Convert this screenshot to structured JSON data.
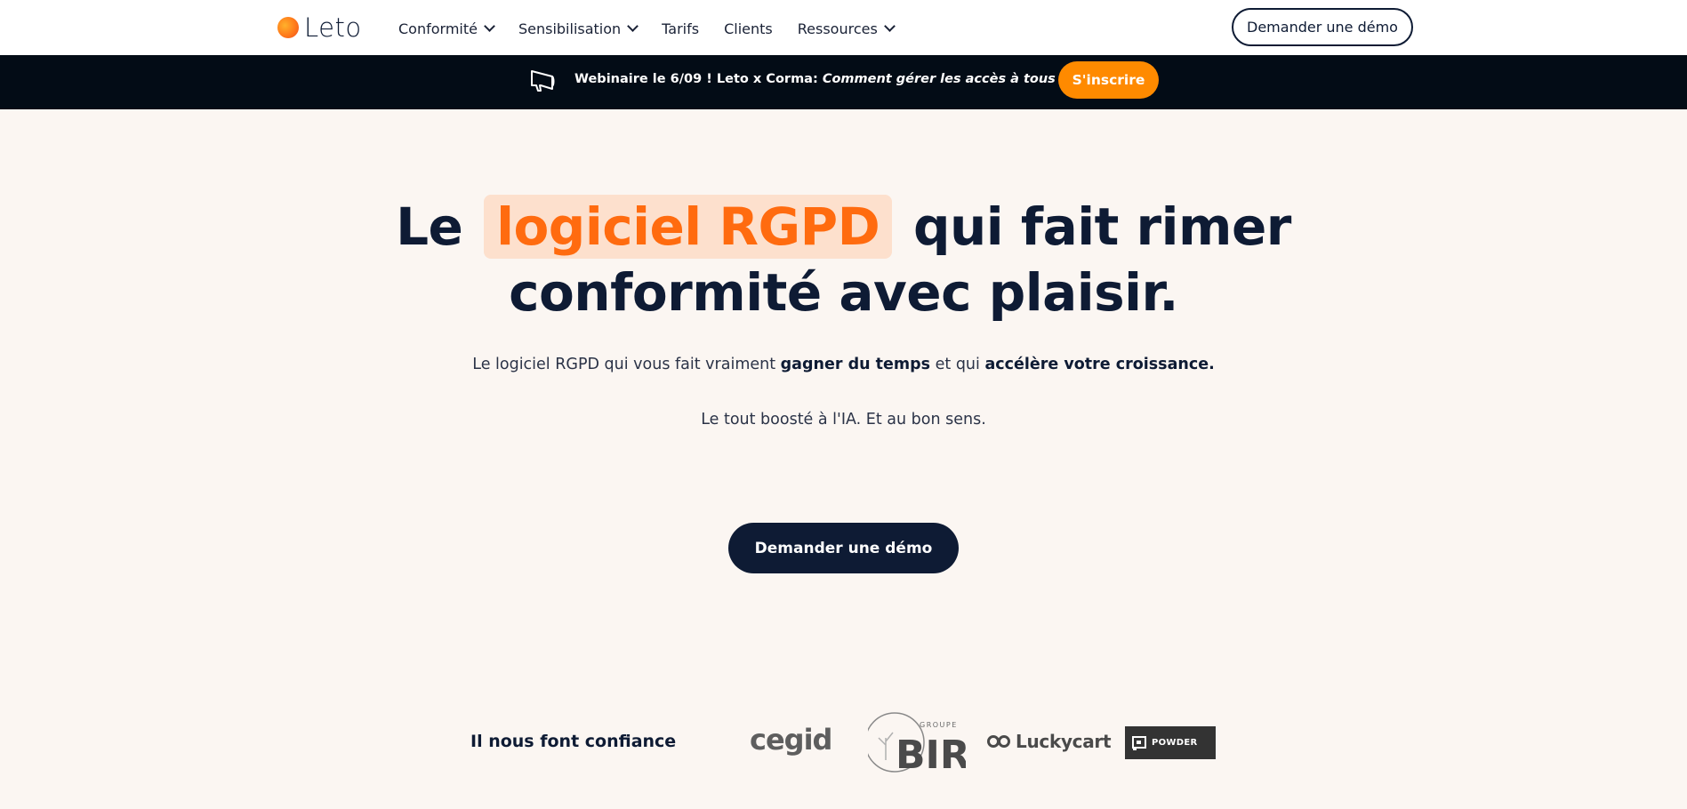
{
  "nav": {
    "logo_text": "Leto",
    "items": [
      {
        "label": "Conformité",
        "has_dropdown": true
      },
      {
        "label": "Sensibilisation",
        "has_dropdown": true
      },
      {
        "label": "Tarifs",
        "has_dropdown": false
      },
      {
        "label": "Clients",
        "has_dropdown": false
      },
      {
        "label": "Ressources",
        "has_dropdown": true
      }
    ],
    "demo_button": "Demander une démo"
  },
  "banner": {
    "icon": "megaphone-icon",
    "text_prefix": "Webinaire le 6/09 ! Leto x Corma: ",
    "text_italic": "Comment gérer les accès à tous vos logiciels?",
    "button": "S'inscrire"
  },
  "hero": {
    "title_part1": "Le",
    "title_highlight": "logiciel RGPD",
    "title_part2": "qui fait rimer",
    "title_line2": "conformité avec plaisir.",
    "subtitle_a": "Le logiciel RGPD qui vous fait vraiment ",
    "subtitle_b": "gagner du temps",
    "subtitle_c": " et qui ",
    "subtitle_d": "accélère votre croissance.",
    "subtitle2": "Le tout boosté à l'IA. Et au bon sens.",
    "cta": "Demander une démo"
  },
  "trust": {
    "label": "Il nous font confiance",
    "logos": {
      "cegid": "cegid",
      "bir_small": "GROUPE",
      "bir_big": "BIR",
      "luckycart": "Luckycart",
      "powder": "POWDER"
    }
  },
  "colors": {
    "accent": "#ff6b0f",
    "banner_bg": "#030c16",
    "banner_button": "#ff8a00",
    "navy": "#0e1b34",
    "page_bg": "#fbf6f2"
  }
}
